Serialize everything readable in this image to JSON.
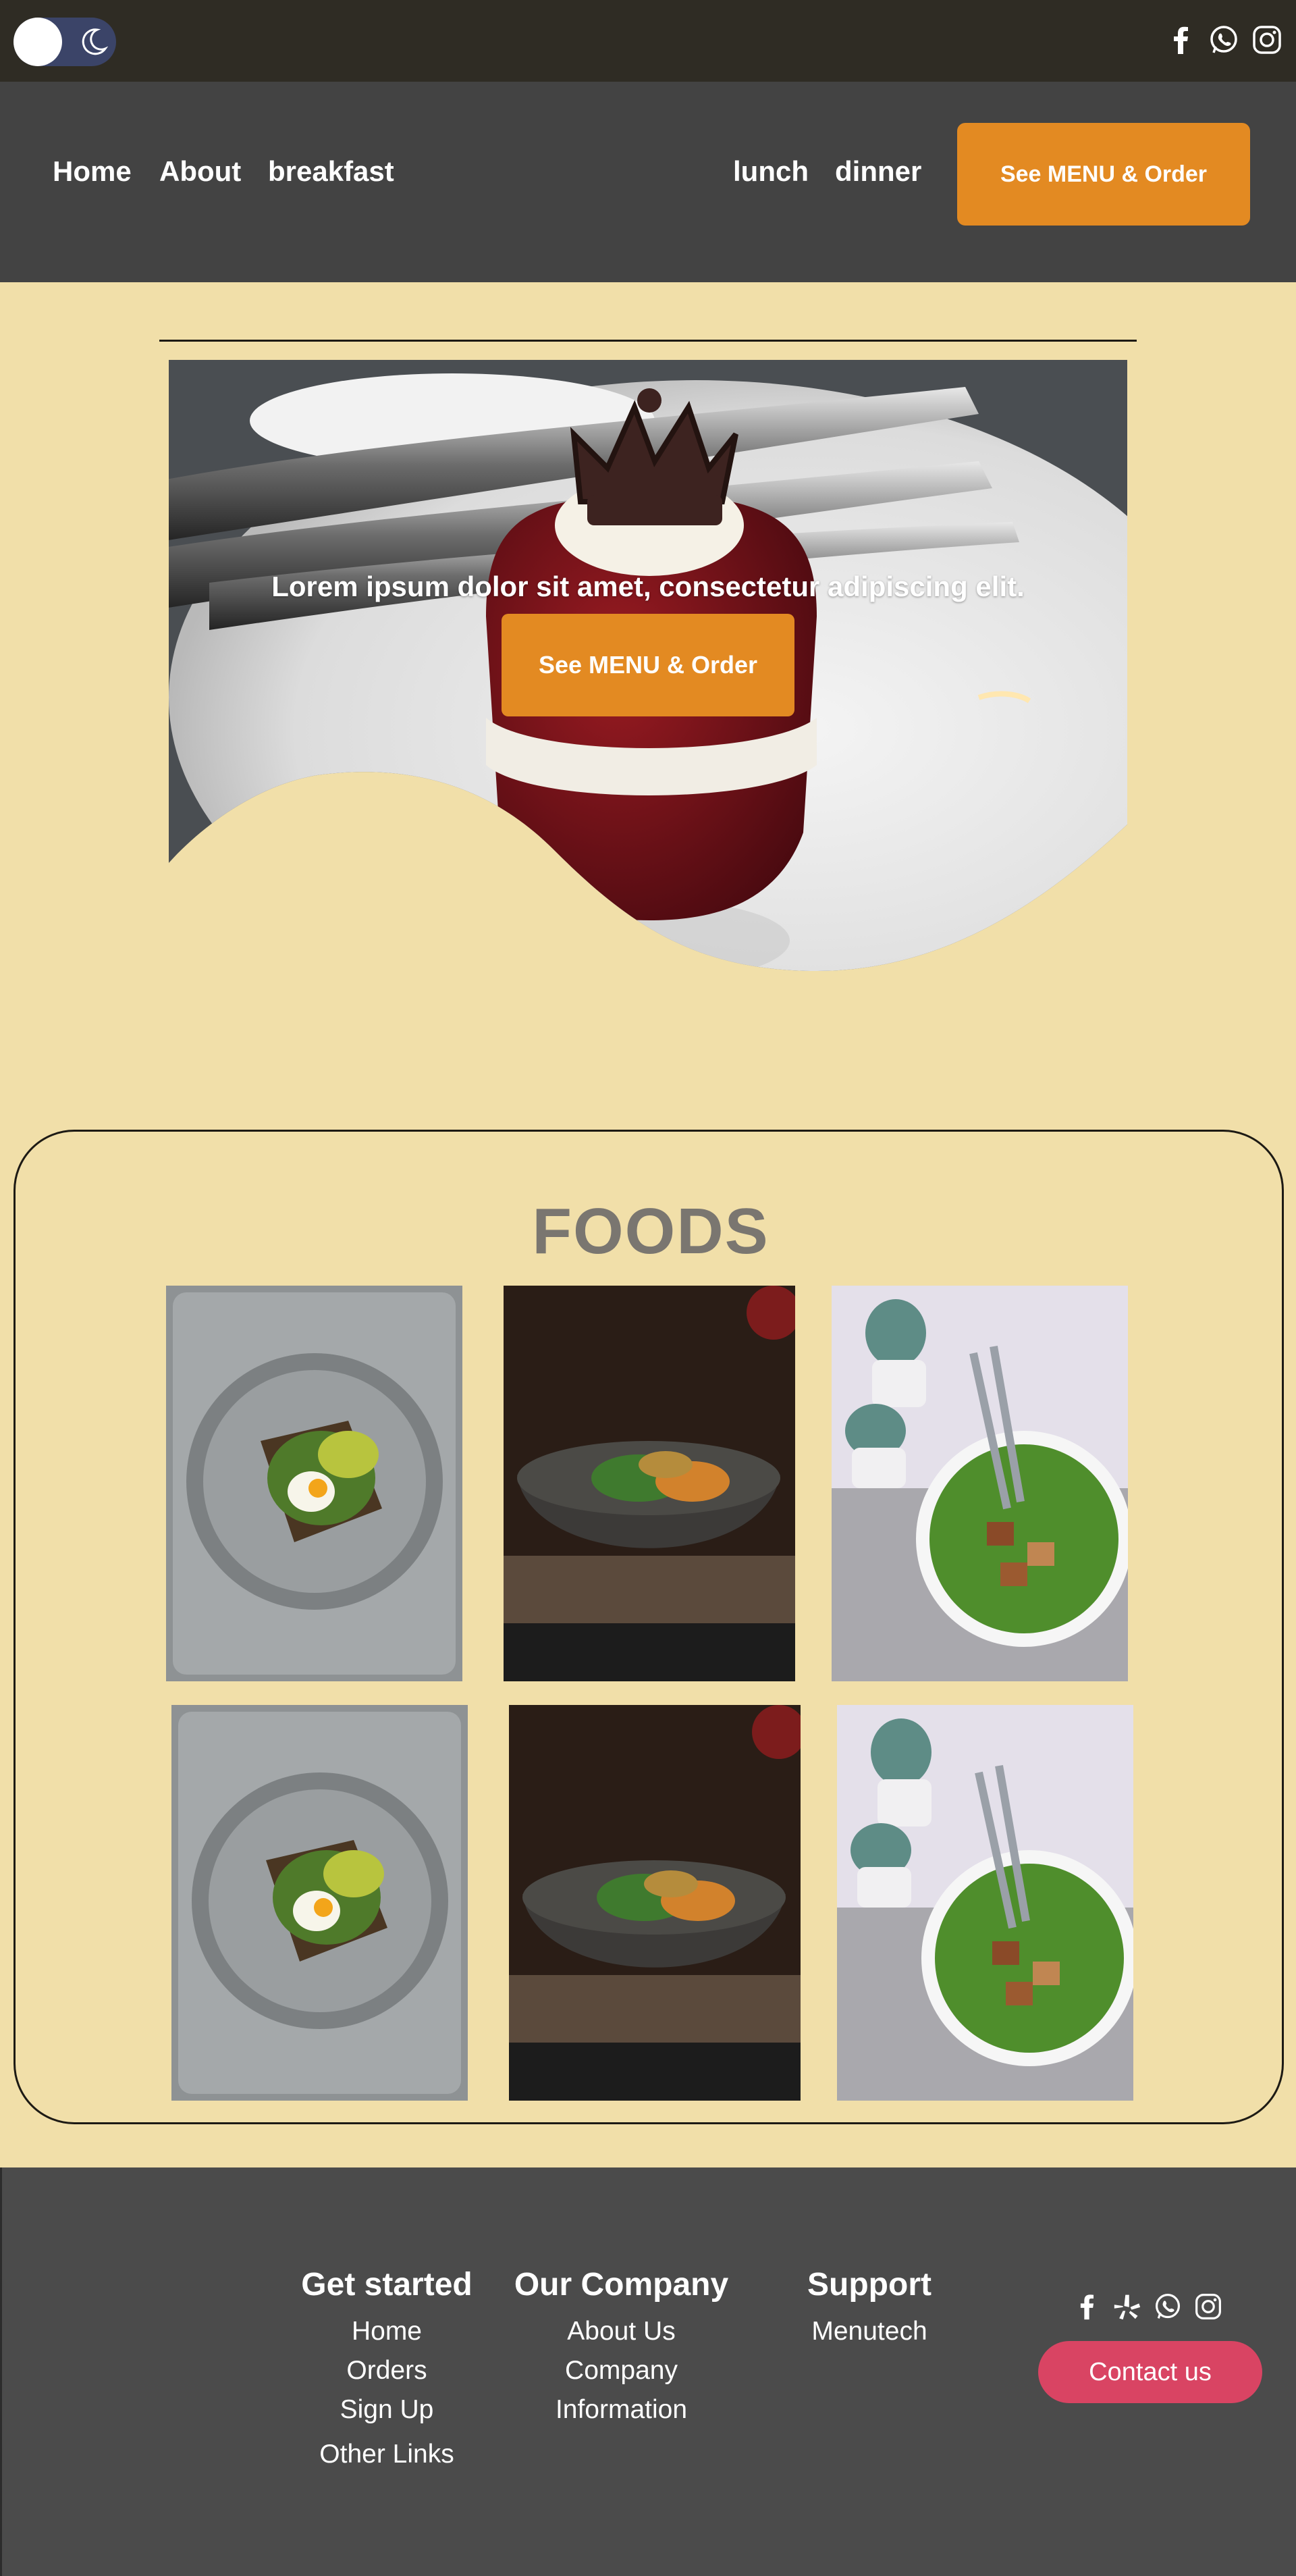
{
  "topbar": {
    "theme_toggle": {
      "state": "light",
      "icons": [
        "sun-knob",
        "moon-icon"
      ]
    },
    "social_icons": [
      "facebook-icon",
      "whatsapp-icon",
      "instagram-icon"
    ]
  },
  "nav": {
    "links": [
      "Home",
      "About",
      "breakfast",
      "lunch",
      "dinner"
    ],
    "order_button": "See MENU & Order"
  },
  "hero": {
    "tagline": "Lorem ipsum dolor sit amet, consectetur adipiscing elit.",
    "button": "See MENU & Order"
  },
  "foods": {
    "title": "FOODS",
    "items": [
      "avocado toast",
      "vegetable bowl",
      "tofu salad",
      "avocado toast",
      "vegetable bowl",
      "tofu salad"
    ]
  },
  "footer": {
    "columns": [
      {
        "heading": "Get started",
        "links": [
          "Home",
          "Orders",
          "Sign Up",
          "Other Links"
        ]
      },
      {
        "heading": "Our Company",
        "links": [
          "About Us",
          "Company",
          "Information"
        ]
      },
      {
        "heading": "Support",
        "links": [
          "Menutech"
        ]
      }
    ],
    "social_icons": [
      "facebook-icon",
      "yelp-icon",
      "whatsapp-icon",
      "instagram-icon"
    ],
    "contact_button": "Contact us"
  },
  "colors": {
    "page_background": "#f1dfa9",
    "topbar": "#2f2c24",
    "nav": "#434343",
    "accent_orange": "#e38a22",
    "footer": "#4b4b4b",
    "contact_pink": "#d94463"
  }
}
